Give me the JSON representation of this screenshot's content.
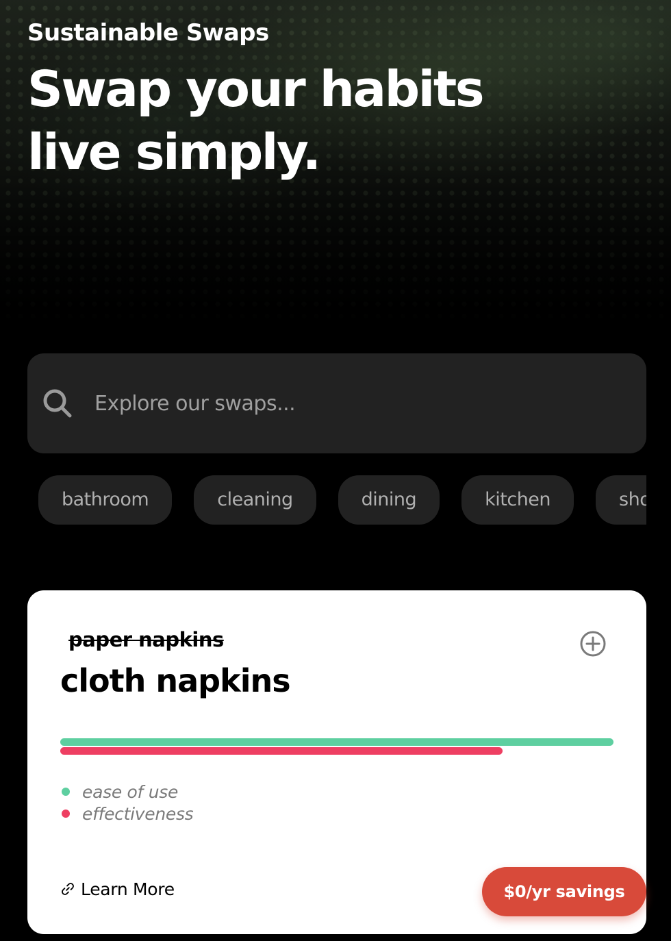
{
  "header": {
    "brand": "Sustainable Swaps",
    "headline_line1": "Swap your habits",
    "headline_line2": "live simply."
  },
  "search": {
    "icon": "search-icon",
    "placeholder": "Explore our swaps...",
    "value": ""
  },
  "categories": [
    "bathroom",
    "cleaning",
    "dining",
    "kitchen",
    "shopping"
  ],
  "swap_card": {
    "old_item": "paper napkins",
    "new_item": "cloth napkins",
    "add_icon": "plus-circle-icon",
    "ratings": {
      "ease_of_use": {
        "label": "ease of use",
        "value": 1.0,
        "color": "#5ecfa0"
      },
      "effectiveness": {
        "label": "effectiveness",
        "value": 0.8,
        "color": "#ee3f62"
      }
    },
    "learn_more": {
      "icon": "link-icon",
      "label": "Learn More"
    },
    "savings_label": "$0/yr savings"
  },
  "colors": {
    "background": "#000000",
    "surface": "#222222",
    "accent_savings": "#d84a3a"
  }
}
